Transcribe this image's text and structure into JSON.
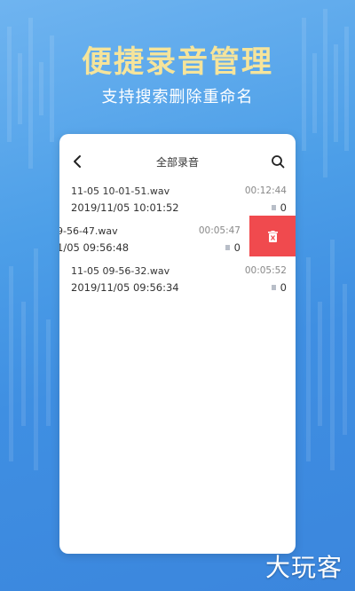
{
  "promo": {
    "headline": "便捷录音管理",
    "subline": "支持搜索删除重命名"
  },
  "app": {
    "title": "全部录音",
    "icons": {
      "back": "back-arrow-icon",
      "search": "search-icon",
      "delete": "trash-icon",
      "tag": "tag-icon"
    }
  },
  "recordings": [
    {
      "name": "11-05 10-01-51.wav",
      "date": "2019/11/05 10:01:52",
      "duration": "00:12:44",
      "count": "0"
    },
    {
      "name": "9-56-47.wav",
      "date": "1/05 09:56:48",
      "duration": "00:05:47",
      "count": "0"
    },
    {
      "name": "11-05 09-56-32.wav",
      "date": "2019/11/05 09:56:34",
      "duration": "00:05:52",
      "count": "0"
    }
  ],
  "watermark": "大玩客",
  "colors": {
    "headline": "#f5e49b",
    "delete": "#f04a4e",
    "background": "#4d9fe8"
  }
}
